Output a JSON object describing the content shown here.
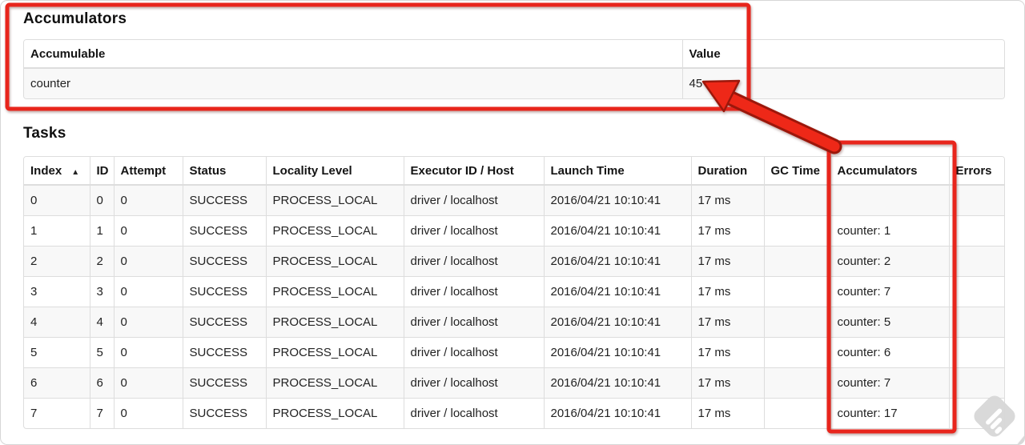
{
  "colors": {
    "annotation_red": "#e8251c",
    "annotation_red_fill": "#ee2818",
    "annotation_red_dark": "#9c170b",
    "table_border": "#dddddd",
    "stripe": "#f8f8f8",
    "watermark_gray": "#d8d8d8"
  },
  "accumulators": {
    "title": "Accumulators",
    "table": {
      "columns": [
        {
          "key": "accumulable",
          "label": "Accumulable"
        },
        {
          "key": "value",
          "label": "Value"
        }
      ],
      "rows": [
        {
          "accumulable": "counter",
          "value": "45"
        }
      ]
    }
  },
  "tasks": {
    "title": "Tasks",
    "table": {
      "columns": [
        {
          "key": "index",
          "label": "Index",
          "sort": "▲"
        },
        {
          "key": "id",
          "label": "ID"
        },
        {
          "key": "attempt",
          "label": "Attempt"
        },
        {
          "key": "status",
          "label": "Status"
        },
        {
          "key": "locality",
          "label": "Locality Level"
        },
        {
          "key": "executor",
          "label": "Executor ID / Host"
        },
        {
          "key": "launch",
          "label": "Launch Time"
        },
        {
          "key": "duration",
          "label": "Duration"
        },
        {
          "key": "gc_time",
          "label": "GC Time"
        },
        {
          "key": "accumulators",
          "label": "Accumulators"
        },
        {
          "key": "errors",
          "label": "Errors"
        }
      ],
      "rows": [
        {
          "index": "0",
          "id": "0",
          "attempt": "0",
          "status": "SUCCESS",
          "locality": "PROCESS_LOCAL",
          "executor": "driver / localhost",
          "launch": "2016/04/21 10:10:41",
          "duration": "17 ms",
          "gc_time": "",
          "accumulators": "",
          "errors": ""
        },
        {
          "index": "1",
          "id": "1",
          "attempt": "0",
          "status": "SUCCESS",
          "locality": "PROCESS_LOCAL",
          "executor": "driver / localhost",
          "launch": "2016/04/21 10:10:41",
          "duration": "17 ms",
          "gc_time": "",
          "accumulators": "counter: 1",
          "errors": ""
        },
        {
          "index": "2",
          "id": "2",
          "attempt": "0",
          "status": "SUCCESS",
          "locality": "PROCESS_LOCAL",
          "executor": "driver / localhost",
          "launch": "2016/04/21 10:10:41",
          "duration": "17 ms",
          "gc_time": "",
          "accumulators": "counter: 2",
          "errors": ""
        },
        {
          "index": "3",
          "id": "3",
          "attempt": "0",
          "status": "SUCCESS",
          "locality": "PROCESS_LOCAL",
          "executor": "driver / localhost",
          "launch": "2016/04/21 10:10:41",
          "duration": "17 ms",
          "gc_time": "",
          "accumulators": "counter: 7",
          "errors": ""
        },
        {
          "index": "4",
          "id": "4",
          "attempt": "0",
          "status": "SUCCESS",
          "locality": "PROCESS_LOCAL",
          "executor": "driver / localhost",
          "launch": "2016/04/21 10:10:41",
          "duration": "17 ms",
          "gc_time": "",
          "accumulators": "counter: 5",
          "errors": ""
        },
        {
          "index": "5",
          "id": "5",
          "attempt": "0",
          "status": "SUCCESS",
          "locality": "PROCESS_LOCAL",
          "executor": "driver / localhost",
          "launch": "2016/04/21 10:10:41",
          "duration": "17 ms",
          "gc_time": "",
          "accumulators": "counter: 6",
          "errors": ""
        },
        {
          "index": "6",
          "id": "6",
          "attempt": "0",
          "status": "SUCCESS",
          "locality": "PROCESS_LOCAL",
          "executor": "driver / localhost",
          "launch": "2016/04/21 10:10:41",
          "duration": "17 ms",
          "gc_time": "",
          "accumulators": "counter: 7",
          "errors": ""
        },
        {
          "index": "7",
          "id": "7",
          "attempt": "0",
          "status": "SUCCESS",
          "locality": "PROCESS_LOCAL",
          "executor": "driver / localhost",
          "launch": "2016/04/21 10:10:41",
          "duration": "17 ms",
          "gc_time": "",
          "accumulators": "counter: 17",
          "errors": ""
        }
      ]
    }
  }
}
